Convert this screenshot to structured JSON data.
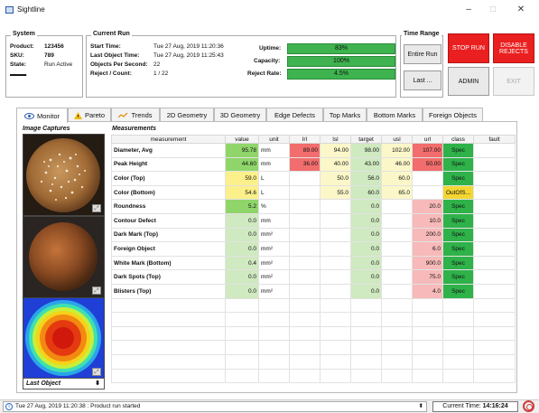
{
  "window": {
    "title": "Sightline",
    "minimize": "–",
    "maximize": "□",
    "close": "✕"
  },
  "system": {
    "title": "System",
    "product_label": "Product:",
    "product": "123456",
    "sku_label": "SKU:",
    "sku": "789",
    "state_label": "State:",
    "state": "Run Active",
    "logo_text": "▬▬.▬"
  },
  "current_run": {
    "title": "Current Run",
    "start_label": "Start Time:",
    "start": "Tue 27 Aug, 2019 11:20:36",
    "last_label": "Last Object Time:",
    "last": "Tue 27 Aug, 2019 11:25:43",
    "ops_label": "Objects Per Second:",
    "ops": "22",
    "reject_label": "Reject / Count:",
    "reject": "1 / 22",
    "uptime_label": "Uptime:",
    "uptime": "83%",
    "uptime_fraction": 0.83,
    "capacity_label": "Capacity:",
    "capacity": "100%",
    "capacity_fraction": 1.0,
    "reject_rate_label": "Reject Rate:",
    "reject_rate": "4.5%",
    "reject_rate_fraction": 1.0
  },
  "time_range": {
    "title": "Time Range",
    "entire_run": "Entire Run",
    "last": "Last ..."
  },
  "buttons": {
    "stop_run": "STOP RUN",
    "disable_rejects": "DISABLE REJECTS",
    "admin": "ADMIN",
    "exit": "EXIT"
  },
  "tabs": [
    {
      "label": "Monitor",
      "icon": "eye-icon"
    },
    {
      "label": "Pareto",
      "icon": "warning-icon"
    },
    {
      "label": "Trends",
      "icon": "trend-icon"
    },
    {
      "label": "2D Geometry"
    },
    {
      "label": "3D Geometry"
    },
    {
      "label": "Edge Defects"
    },
    {
      "label": "Top Marks"
    },
    {
      "label": "Bottom Marks"
    },
    {
      "label": "Foreign Objects"
    }
  ],
  "image_captures": {
    "title": "Image Captures",
    "select_value": "Last Object"
  },
  "measurements": {
    "title": "Measurements",
    "columns": [
      "measurement",
      "value",
      "unit",
      "lrl",
      "lsl",
      "target",
      "usl",
      "url",
      "class",
      "fault"
    ],
    "rows": [
      [
        "Diameter, Avg",
        "95.78",
        "mm",
        "89.00",
        "94.00",
        "98.00",
        "102.00",
        "107.00",
        "Spec",
        ""
      ],
      [
        "Peak Height",
        "44.60",
        "mm",
        "36.00",
        "40.00",
        "43.00",
        "46.00",
        "50.00",
        "Spec",
        ""
      ],
      [
        "Color (Top)",
        "59.0",
        "L",
        "",
        "50.0",
        "56.0",
        "60.0",
        "",
        "Spec",
        ""
      ],
      [
        "Color (Bottom)",
        "54.6",
        "L",
        "",
        "55.0",
        "60.0",
        "65.0",
        "",
        "OutOfS...",
        ""
      ],
      [
        "Roundness",
        "5.2",
        "%",
        "",
        "",
        "0.0",
        "",
        "20.0",
        "Spec",
        ""
      ],
      [
        "Contour Defect",
        "0.0",
        "mm",
        "",
        "",
        "0.0",
        "",
        "10.0",
        "Spec",
        ""
      ],
      [
        "Dark Mark (Top)",
        "0.0",
        "mm²",
        "",
        "",
        "0.0",
        "",
        "200.0",
        "Spec",
        ""
      ],
      [
        "Foreign Object",
        "0.0",
        "mm²",
        "",
        "",
        "0.0",
        "",
        "6.0",
        "Spec",
        ""
      ],
      [
        "White Mark (Bottom)",
        "0.4",
        "mm²",
        "",
        "",
        "0.0",
        "",
        "900.0",
        "Spec",
        ""
      ],
      [
        "Dark Spots (Top)",
        "0.0",
        "mm²",
        "",
        "",
        "0.0",
        "",
        "75.0",
        "Spec",
        ""
      ],
      [
        "Blisters (Top)",
        "0.0",
        "mm²",
        "",
        "",
        "0.0",
        "",
        "4.0",
        "Spec",
        ""
      ]
    ],
    "empty_rows": 6
  },
  "status": {
    "message": "Tue 27 Aug, 2019 11:20:38 : Product run started",
    "updown": "⬍",
    "current_time_label": "Current Time:",
    "current_time": "14:16:24"
  }
}
